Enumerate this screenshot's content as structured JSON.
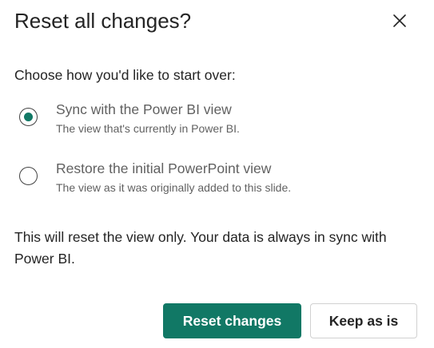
{
  "dialog": {
    "title": "Reset all changes?",
    "close_icon": "close-icon",
    "prompt": "Choose how you'd like to start over:",
    "options": [
      {
        "label": "Sync with the Power BI view",
        "description": "The view that's currently in Power BI.",
        "selected": true
      },
      {
        "label": "Restore the initial PowerPoint view",
        "description": "The view as it was originally added to this slide.",
        "selected": false
      }
    ],
    "note": "This will reset the view only. Your data is always in sync with Power BI.",
    "primary_button": "Reset changes",
    "secondary_button": "Keep as is"
  },
  "colors": {
    "accent": "#117865",
    "text": "#242424",
    "secondary_text": "#616161",
    "border": "#d1d1d1"
  }
}
